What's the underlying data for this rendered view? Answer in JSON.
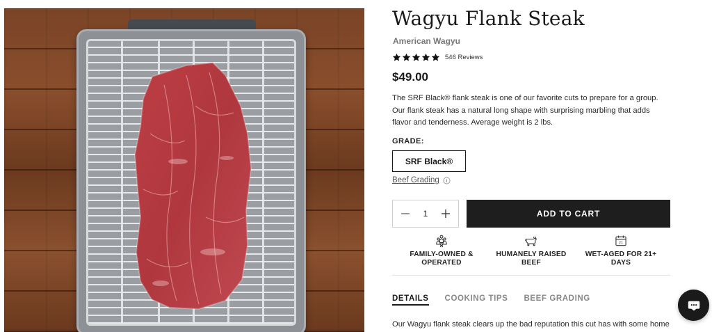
{
  "product": {
    "title": "Wagyu Flank Steak",
    "subtitle": "American Wagyu",
    "rating": 5,
    "reviews_label": "546 Reviews",
    "price": "$49.00",
    "description": "The SRF Black® flank steak is one of our favorite cuts to prepare for a group. Our flank steak has a natural long shape with surprising marbling that adds flavor and tenderness. Average weight is 2 lbs.",
    "image_icon": "flank-steak-on-rack-photo"
  },
  "grade": {
    "label": "GRADE:",
    "selected": "SRF Black®",
    "grading_link": "Beef Grading"
  },
  "purchase": {
    "quantity": "1",
    "add_to_cart_label": "ADD TO CART"
  },
  "features": [
    {
      "icon": "family-icon",
      "label": "FAMILY-OWNED & OPERATED"
    },
    {
      "icon": "cow-icon",
      "label": "HUMANELY RAISED BEEF"
    },
    {
      "icon": "calendar-icon",
      "label": "WET-AGED FOR 21+ DAYS"
    }
  ],
  "tabs": [
    {
      "label": "DETAILS",
      "active": true
    },
    {
      "label": "COOKING TIPS",
      "active": false
    },
    {
      "label": "BEEF GRADING",
      "active": false
    }
  ],
  "details_text": "Our Wagyu flank steak clears up the bad reputation this cut has with some home",
  "chat": {
    "icon": "chat-icon"
  },
  "colors": {
    "primary": "#1e1e1e",
    "text": "#222222",
    "muted": "#777777",
    "border": "#cfcfcf"
  }
}
